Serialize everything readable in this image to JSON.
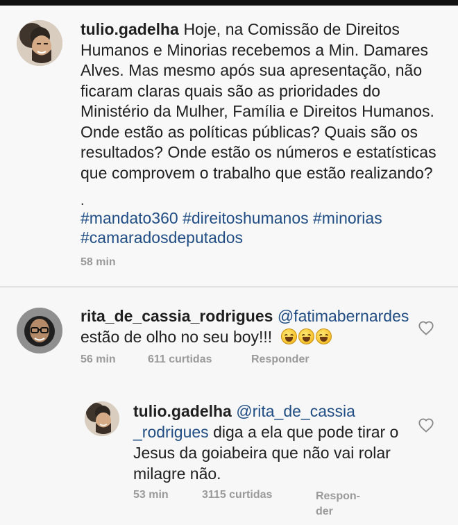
{
  "post": {
    "username": "tulio.gadelha",
    "text": "Hoje, na Comissão de Direitos Humanos e Minorias recebemos a Min. Damares Alves. Mas mesmo após sua apresentação, não ficaram claras quais são as prioridades do Ministério da Mulher, Família e Direitos Humanos. Onde estão as políticas públicas? Quais são os resultados? Onde estão os números e estatísticas que comprovem o trabalho que estão realizando?",
    "dot": ".",
    "hashtags_line1": "#mandato360 #direitoshumanos #minorias",
    "hashtags_line2": "#camaradosdeputados",
    "time": "58 min"
  },
  "comment1": {
    "username": "rita_de_cassia_rodrigues",
    "mention": "@fatimabernardes",
    "text": "estão de olho no seu boy!!!",
    "time": "56 min",
    "likes": "611 curtidas",
    "reply": "Responder",
    "icon": "heart-outline-icon"
  },
  "comment2": {
    "username": "tulio.gadelha",
    "mention": "@rita_de_cassia _rodrigues",
    "text": "diga a ela que pode tirar o Jesus da goiabeira que não vai rolar milagre não.",
    "time": "53 min",
    "likes": "3115 curtidas",
    "reply_line1": "Respon-",
    "reply_line2": "der",
    "icon": "heart-outline-icon"
  },
  "colors": {
    "link": "#1f4d84",
    "meta": "#9a9a9a"
  }
}
